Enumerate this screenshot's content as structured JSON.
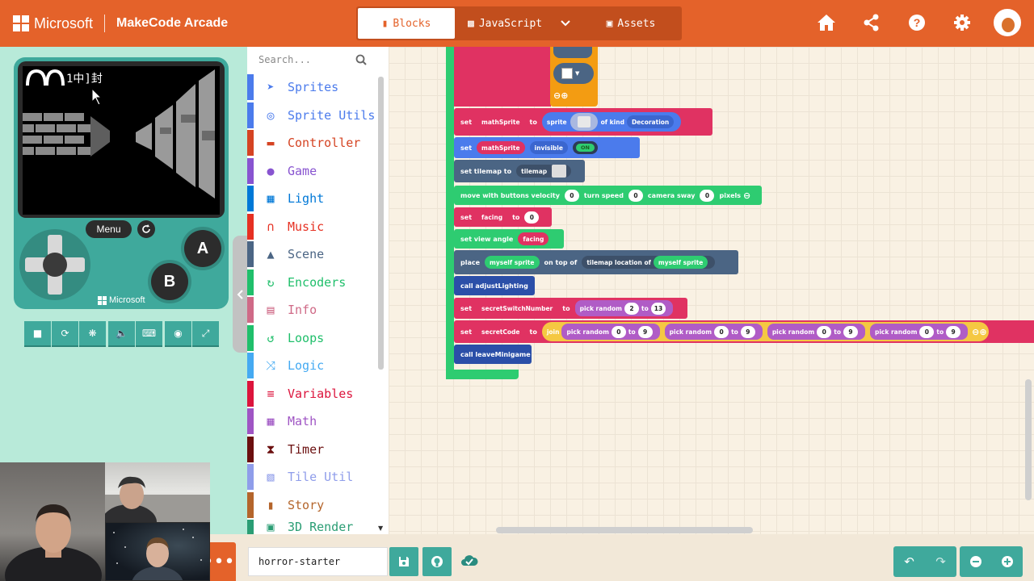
{
  "header": {
    "ms_label": "Microsoft",
    "app_title": "MakeCode Arcade",
    "tabs": {
      "blocks": "Blocks",
      "javascript": "JavaScript",
      "assets": "Assets"
    },
    "icons": [
      "home-icon",
      "share-icon",
      "help-icon",
      "settings-icon",
      "avatar"
    ]
  },
  "simulator": {
    "menu_label": "Menu",
    "button_a": "A",
    "button_b": "B",
    "brand": "Microsoft",
    "hud_text": "∩∩ 1中]封",
    "tools": [
      "stop-icon",
      "restart-icon",
      "debug-icon",
      "sound-icon",
      "keyboard-icon",
      "screenshot-icon",
      "fullscreen-icon"
    ]
  },
  "toolbox": {
    "search_placeholder": "Search...",
    "categories": [
      {
        "label": "Sprites",
        "color": "#4b7bec",
        "icon": "paper-plane-icon"
      },
      {
        "label": "Sprite Utils",
        "color": "#4b7bec",
        "icon": "person-icon"
      },
      {
        "label": "Controller",
        "color": "#d54322",
        "icon": "gamepad-icon"
      },
      {
        "label": "Game",
        "color": "#8854d0",
        "icon": "circle-icon"
      },
      {
        "label": "Light",
        "color": "#0078d7",
        "icon": "grid-icon"
      },
      {
        "label": "Music",
        "color": "#e63022",
        "icon": "headphones-icon"
      },
      {
        "label": "Scene",
        "color": "#4b6584",
        "icon": "tree-icon"
      },
      {
        "label": "Encoders",
        "color": "#20bf6b",
        "icon": "refresh-icon"
      },
      {
        "label": "Info",
        "color": "#cf6a87",
        "icon": "id-card-icon"
      },
      {
        "label": "Loops",
        "color": "#20bf6b",
        "icon": "loop-icon"
      },
      {
        "label": "Logic",
        "color": "#45aaf2",
        "icon": "shuffle-icon"
      },
      {
        "label": "Variables",
        "color": "#dc143c",
        "icon": "list-icon"
      },
      {
        "label": "Math",
        "color": "#9f55c4",
        "icon": "calculator-icon"
      },
      {
        "label": "Timer",
        "color": "#6b0f0f",
        "icon": "hourglass-icon"
      },
      {
        "label": "Tile Util",
        "color": "#8f9dea",
        "icon": "map-icon"
      },
      {
        "label": "Story",
        "color": "#b4652b",
        "icon": "book-icon"
      },
      {
        "label": "3D Render",
        "color": "#2a9d74",
        "icon": "cube-icon"
      }
    ]
  },
  "workspace": {
    "blocks": {
      "b1": {
        "set": "set",
        "var": "mathSprite",
        "to": "to",
        "sprite": "sprite",
        "ofkind": "of kind",
        "kind": "Decoration"
      },
      "b2": {
        "set": "set",
        "var": "mathSprite",
        "prop": "invisible",
        "toggle": "ON"
      },
      "b3": {
        "text": "set tilemap to",
        "tilemap": "tilemap"
      },
      "b4": {
        "text": "move with buttons velocity",
        "v": "0",
        "turn": "turn speed",
        "t": "0",
        "camera": "camera sway",
        "c": "0",
        "pixels": "pixels"
      },
      "b5": {
        "set": "set",
        "var": "facing",
        "to": "to",
        "val": "0"
      },
      "b6": {
        "text": "set view angle",
        "var": "facing"
      },
      "b7": {
        "place": "place",
        "myself": "myself sprite",
        "ontop": "on top of",
        "tilemaploc": "tilemap location of",
        "myself2": "myself sprite"
      },
      "b8": {
        "text": "call adjustLighting"
      },
      "b9": {
        "set": "set",
        "var": "secretSwitchNumber",
        "to": "to",
        "pick": "pick random",
        "a": "2",
        "tolbl": "to",
        "b": "13"
      },
      "b10": {
        "set": "set",
        "var": "secretCode",
        "to": "to",
        "join": "join",
        "pick": "pick random",
        "a": "0",
        "tolbl": "to",
        "b": "9"
      },
      "b11": {
        "text": "call leaveMinigame"
      }
    }
  },
  "footer": {
    "project_name": "horror-starter",
    "more_label": "•••"
  }
}
